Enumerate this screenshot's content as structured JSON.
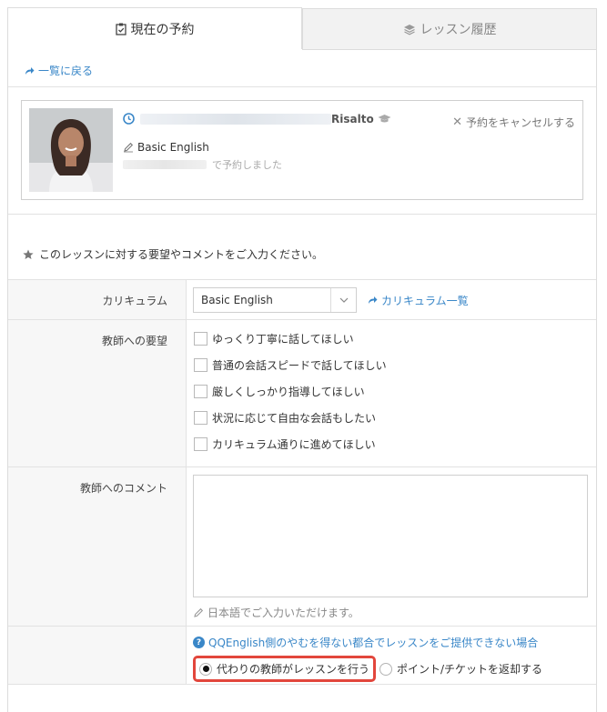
{
  "tabs": [
    {
      "label": "現在の予約",
      "active": true
    },
    {
      "label": "レッスン履歴",
      "active": false
    }
  ],
  "back_link": "一覧に戻る",
  "reservation": {
    "teacher_name": "Risalto",
    "course": "Basic English",
    "booked_suffix": "で予約しました",
    "cancel_label": "予約をキャンセルする"
  },
  "note": "このレッスンに対する要望やコメントをご入力ください。",
  "form": {
    "curriculum_label": "カリキュラム",
    "curriculum_value": "Basic English",
    "curriculum_link": "カリキュラム一覧",
    "requests_label": "教師への要望",
    "requests": [
      "ゆっくり丁寧に話してほしい",
      "普通の会話スピードで話してほしい",
      "厳しくしっかり指導してほしい",
      "状況に応じて自由な会話もしたい",
      "カリキュラム通りに進めてほしい"
    ],
    "comment_label": "教師へのコメント",
    "comment_value": "",
    "comment_hint": "日本語でご入力いただけます。",
    "unavailable_link": "QQEnglish側のやむを得ない都合でレッスンをご提供できない場合",
    "option_substitute": "代わりの教師がレッスンを行う",
    "option_refund": "ポイント/チケットを返却する"
  },
  "colors": {
    "link": "#3a87c8",
    "highlight": "#e2463c"
  }
}
